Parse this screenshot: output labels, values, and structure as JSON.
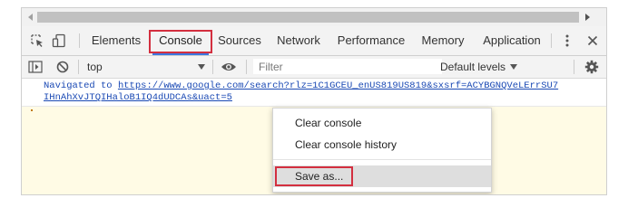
{
  "devtools": {
    "tabs": [
      {
        "label": "Elements"
      },
      {
        "label": "Console",
        "active": true
      },
      {
        "label": "Sources"
      },
      {
        "label": "Network"
      },
      {
        "label": "Performance"
      },
      {
        "label": "Memory"
      },
      {
        "label": "Application"
      }
    ],
    "icons": [
      "inspect-element-icon",
      "device-toolbar-icon",
      "more-options-icon",
      "close-icon"
    ]
  },
  "console_toolbar": {
    "context": "top",
    "filter_placeholder": "Filter",
    "levels": "Default levels",
    "icons": [
      "show-sidebar-icon",
      "clear-console-icon",
      "eye-icon",
      "settings-gear-icon"
    ]
  },
  "messages": {
    "navigated_prefix": "Navigated to",
    "url_line1": "https://www.google.com/search?rlz=1C1GCEU_enUS819US819&sxsrf=ACYBGNQVeLErrSU7",
    "url_line2": "IHnAhXvJTQIHaloB1IQ4dUDCAs&uact=5"
  },
  "context_menu": {
    "items": [
      {
        "label": "Clear console"
      },
      {
        "label": "Clear console history"
      },
      {
        "label": "Save as..."
      }
    ]
  },
  "colors": {
    "highlight_red": "#d32f3f",
    "link_blue": "#1a49b4",
    "active_tab_underline": "#3b76e0",
    "prompt_background": "#fffbe5"
  }
}
